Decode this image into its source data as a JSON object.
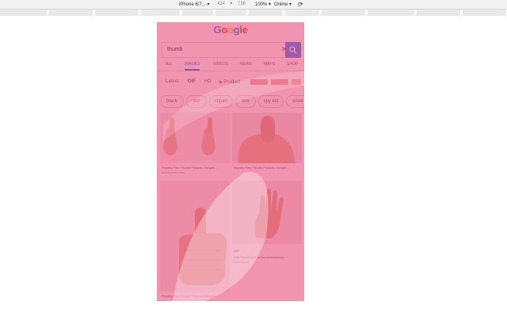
{
  "devtools": {
    "device": "iPhone 6/7...",
    "width": "414",
    "times": "×",
    "height": "736",
    "zoom": "100%",
    "network": "Online"
  },
  "google": {
    "logo_letters": [
      "G",
      "o",
      "o",
      "g",
      "l",
      "e"
    ],
    "logo_colors": [
      "#4285f4",
      "#ea4335",
      "#fbbc05",
      "#4285f4",
      "#34a853",
      "#ea4335"
    ],
    "query": "thumb",
    "clear": "✕"
  },
  "tabs": [
    "ALL",
    "IMAGES",
    "VIDEOS",
    "NEWS",
    "MAPS",
    "SHOP"
  ],
  "filters": {
    "latest": "Latest",
    "gif": "GIF",
    "hd": "HD",
    "product": "Product",
    "swatch_colors": [
      "#e98090",
      "#ee8a7a",
      "#f3a890"
    ]
  },
  "chips": [
    "black",
    "kid",
    "clipart",
    "two",
    "spy kid",
    "smile"
  ],
  "results": [
    {
      "caption": "Royalty Free Thumb Pictures, Images...",
      "source": "istockphoto.com"
    },
    {
      "caption": "Royalty Free Thumb Pictures, Images...",
      "source": ""
    },
    {
      "badge": "GIF",
      "caption": "The 'Rhd thumb' is the unnecessary...",
      "source": "lifehack.org"
    },
    {
      "caption": "Royalty Free Thumb Pictures, Images...",
      "source": ""
    }
  ],
  "colors": {
    "accent": "#1a73e8",
    "overlay": "#e63c6e"
  }
}
